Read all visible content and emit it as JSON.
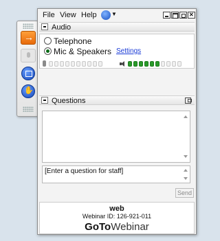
{
  "menu": {
    "file": "File",
    "view": "View",
    "help": "Help"
  },
  "audio": {
    "section_title": "Audio",
    "option_telephone": "Telephone",
    "option_mic": "Mic & Speakers",
    "settings_link": "Settings",
    "selected_option": "Mic & Speakers",
    "mic_level_segments": 0,
    "speaker_level_segments": 6,
    "total_segments": 10
  },
  "questions": {
    "section_title": "Questions",
    "input_placeholder": "[Enter a question for staff]",
    "send_label": "Send"
  },
  "footer": {
    "name": "web",
    "webinar_id": "Webinar ID: 126-921-011",
    "logo_bold": "GoTo",
    "logo_light": "Webinar"
  },
  "colors": {
    "accent_orange": "#f07c1a",
    "meter_green": "#2a9a2a",
    "link_blue": "#1a3bd6"
  },
  "icons": [
    "arrow-icon",
    "microphone-icon",
    "screen-icon",
    "raise-hand-icon",
    "globe-icon",
    "minimize-icon",
    "maximize-icon",
    "restore-icon",
    "close-icon",
    "collapse-icon",
    "popout-icon",
    "speaker-icon"
  ]
}
